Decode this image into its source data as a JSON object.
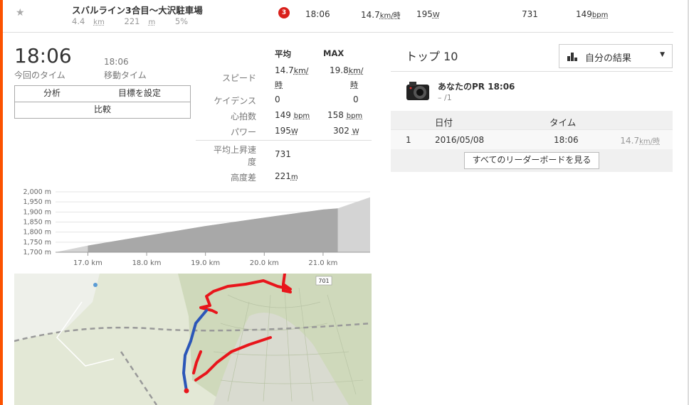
{
  "segment": {
    "title": "スバルライン3合目～大沢駐車場",
    "distance": "4.4",
    "distance_unit": "km",
    "elevation": "221",
    "elevation_unit": "m",
    "grade": "5%",
    "category": "3",
    "time": "18:06",
    "speed": "14.7",
    "speed_unit": "km/時",
    "power": "195",
    "power_unit": "W",
    "vam": "731",
    "hr": "149",
    "hr_unit": "bpm"
  },
  "effort": {
    "elapsed_time": "18:06",
    "elapsed_label": "今回のタイム",
    "moving_time": "18:06",
    "moving_label": "移動タイム",
    "analyze_btn": "分析",
    "set_goal_btn": "目標を設定",
    "compare_btn": "比較"
  },
  "stats": {
    "avg_header": "平均",
    "max_header": "MAX",
    "speed_label": "スピード",
    "speed_avg": "14.7",
    "speed_max": "19.8",
    "speed_unit": "km/",
    "speed_unit2": "時",
    "cadence_label": "ケイデンス",
    "cadence_avg": "0",
    "cadence_max": "0",
    "hr_label": "心拍数",
    "hr_avg": "149",
    "hr_max": "158",
    "hr_unit": "bpm",
    "power_label": "パワー",
    "power_avg": "195",
    "power_max": "302",
    "power_unit": "W",
    "vam_label_1": "平均上昇速",
    "vam_label_2": "度",
    "vam_value": "731",
    "elev_label": "高度差",
    "elev_value": "221",
    "elev_unit": "m"
  },
  "chart_data": {
    "type": "area",
    "title": "",
    "xlabel": "",
    "ylabel": "",
    "ylim": [
      1700,
      2000
    ],
    "xlim": [
      16.45,
      21.8
    ],
    "yticks": [
      "2,000 m",
      "1,950 m",
      "1,900 m",
      "1,850 m",
      "1,800 m",
      "1,750 m",
      "1,700 m"
    ],
    "xticks": [
      "17.0 km",
      "18.0 km",
      "19.0 km",
      "20.0 km",
      "21.0 km"
    ],
    "segment_range": [
      17.0,
      21.25
    ],
    "x": [
      16.45,
      17.0,
      18.0,
      19.0,
      20.0,
      21.0,
      21.25,
      21.8
    ],
    "values": [
      1700,
      1733,
      1782,
      1830,
      1872,
      1912,
      1918,
      1973
    ],
    "grid": true
  },
  "map": {
    "road_number": "701"
  },
  "leaderboard": {
    "title": "トップ 10",
    "filter_label": "自分の結果",
    "pr_label": "あなたのPR 18:06",
    "pr_sub": "– /1",
    "col_date": "日付",
    "col_time": "タイム",
    "rows": [
      {
        "rank": "1",
        "date": "2016/05/08",
        "time": "18:06",
        "speed": "14.7",
        "speed_unit": "km/時"
      }
    ],
    "view_all": "すべてのリーダーボードを見る"
  },
  "colors": {
    "accent": "#fc5200",
    "route": "#e8151b",
    "effort_path": "#2b56b8",
    "category_badge": "#d9201b"
  }
}
